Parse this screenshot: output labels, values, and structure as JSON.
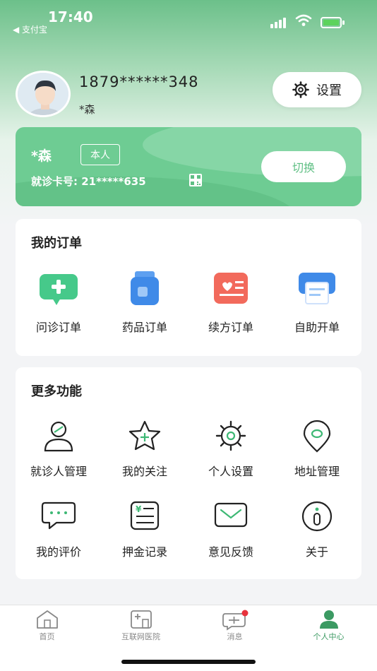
{
  "status_bar": {
    "time": "17:40",
    "back_app": "◀ 支付宝"
  },
  "profile": {
    "phone": "1879******348",
    "nickname": "*森",
    "settings_label": "设置"
  },
  "card": {
    "name": "*森",
    "tag": "本人",
    "card_number": "就诊卡号: 21*****635",
    "switch_label": "切换"
  },
  "orders": {
    "title": "我的订单",
    "items": [
      {
        "label": "问诊订单",
        "icon": "consult-order-icon"
      },
      {
        "label": "药品订单",
        "icon": "medicine-order-icon"
      },
      {
        "label": "续方订单",
        "icon": "prescription-order-icon"
      },
      {
        "label": "自助开单",
        "icon": "self-order-icon"
      }
    ]
  },
  "more": {
    "title": "更多功能",
    "items": [
      {
        "label": "就诊人管理",
        "icon": "patient-icon"
      },
      {
        "label": "我的关注",
        "icon": "star-icon"
      },
      {
        "label": "个人设置",
        "icon": "gear-icon"
      },
      {
        "label": "地址管理",
        "icon": "location-icon"
      },
      {
        "label": "我的评价",
        "icon": "comment-icon"
      },
      {
        "label": "押金记录",
        "icon": "deposit-icon"
      },
      {
        "label": "意见反馈",
        "icon": "mail-icon"
      },
      {
        "label": "关于",
        "icon": "info-icon"
      }
    ]
  },
  "tabbar": {
    "items": [
      {
        "label": "首页",
        "icon": "home-icon"
      },
      {
        "label": "互联网医院",
        "icon": "hospital-icon"
      },
      {
        "label": "消息",
        "icon": "message-icon"
      },
      {
        "label": "个人中心",
        "icon": "user-icon"
      }
    ]
  },
  "colors": {
    "brand": "#5fbf84",
    "badge": "#e8323c"
  }
}
